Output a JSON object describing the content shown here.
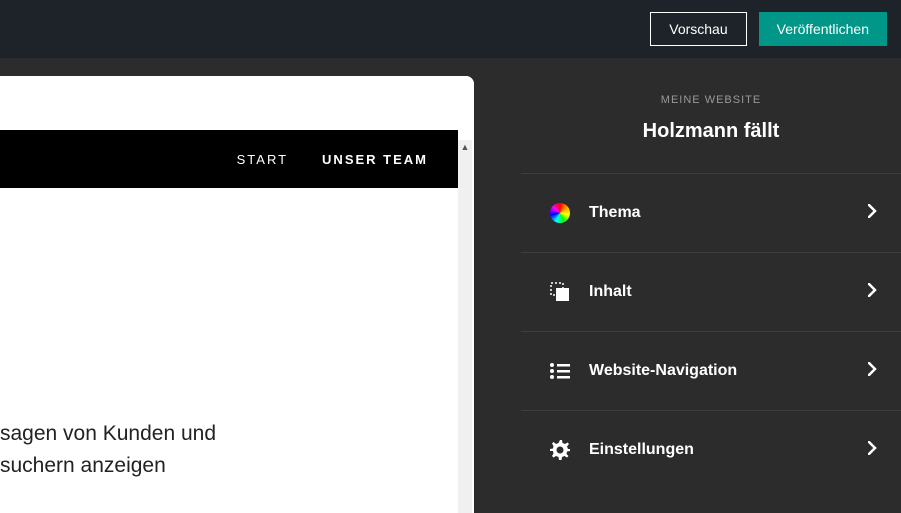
{
  "topbar": {
    "preview_label": "Vorschau",
    "publish_label": "Veröffentlichen"
  },
  "preview": {
    "nav": {
      "start": "START",
      "team": "UNSER TEAM"
    },
    "content_line1": "sagen von Kunden und",
    "content_line2": "suchern anzeigen"
  },
  "sidebar": {
    "eyebrow": "MEINE WEBSITE",
    "title": "Holzmann fällt",
    "items": [
      {
        "label": "Thema"
      },
      {
        "label": "Inhalt"
      },
      {
        "label": "Website-Navigation"
      },
      {
        "label": "Einstellungen"
      }
    ]
  }
}
